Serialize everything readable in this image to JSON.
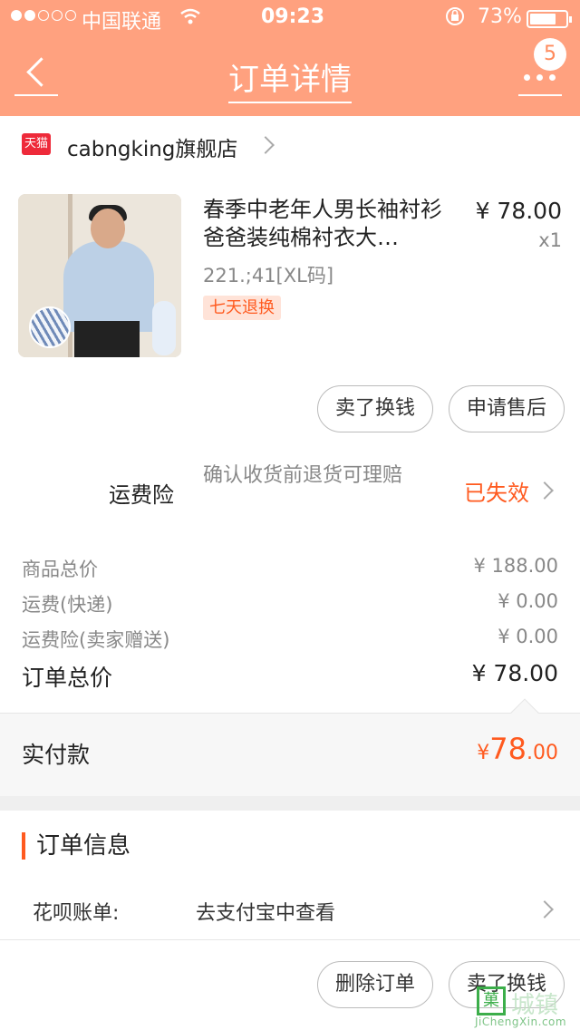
{
  "status": {
    "carrier": "中国联通",
    "time": "09:23",
    "battery": "73%",
    "wifi_icon": "wifi-icon",
    "lock_icon": "rotation-lock-icon"
  },
  "nav": {
    "title": "订单详情",
    "badge": "5"
  },
  "shop": {
    "tmall_badge": "天猫",
    "name": "cabngking旗舰店"
  },
  "product": {
    "title": "春季中老年人男长袖衬衫爸爸装纯棉衬衣大…",
    "price": "¥ 78.00",
    "qty": "x1",
    "sku": "221.;41[XL码]",
    "tag": "七天退换"
  },
  "item_actions": {
    "sell_label": "卖了换钱",
    "after_sale_label": "申请售后"
  },
  "insurance": {
    "label": "运费险",
    "desc": "确认收货前退货可理赔",
    "status": "已失效"
  },
  "summary": {
    "goods_label": "商品总价",
    "goods_value": "¥ 188.00",
    "ship_label": "运费(快递)",
    "ship_value": "¥ 0.00",
    "ins_label": "运费险(卖家赠送)",
    "ins_value": "¥ 0.00",
    "total_label": "订单总价",
    "total_value": "¥ 78.00"
  },
  "payment": {
    "label": "实付款",
    "currency": "¥",
    "integer": "78",
    "decimal": ".00"
  },
  "order_info": {
    "title": "订单信息",
    "huabei_label": "花呗账单:",
    "huabei_value": "去支付宝中查看"
  },
  "bottom_actions": {
    "delete_label": "删除订单",
    "sell_label": "卖了换钱"
  },
  "watermark": {
    "mark": "菓",
    "text": "城镇",
    "url": "JiChengXin.com"
  },
  "colors": {
    "header": "#ffa17f",
    "accent": "#ff5a1f"
  }
}
